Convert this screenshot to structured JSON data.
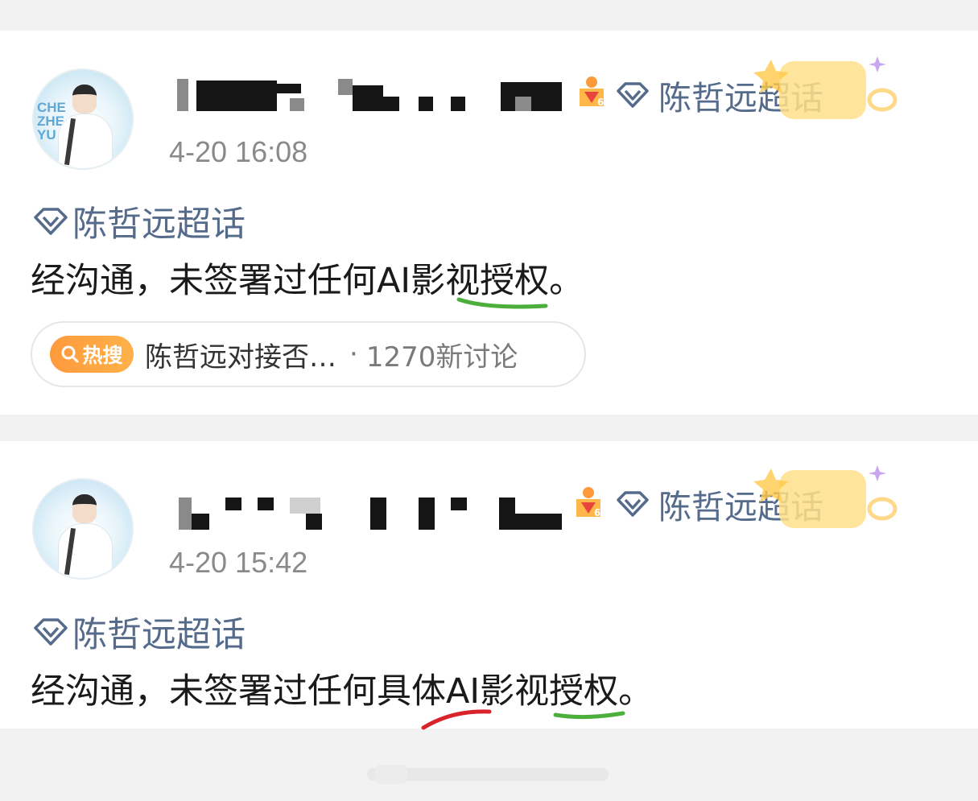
{
  "posts": [
    {
      "time": "4-20 16:08",
      "topic_chip": "陈哲远超话",
      "super_topic": "陈哲远超话",
      "content": "经沟通，未签署过任何AI影视授权。",
      "hot": {
        "tag": "热搜",
        "title": "陈哲远对接否…",
        "count": "1270新讨论"
      }
    },
    {
      "time": "4-20 15:42",
      "topic_chip": "陈哲远超话",
      "super_topic": "陈哲远超话",
      "content": "经沟通，未签署过任何具体AI影视授权。"
    }
  ],
  "avatar_text": "CHE ZHE YU",
  "colors": {
    "topic_blue": "#556b8c",
    "hot_orange": "#ff9a3c",
    "underline_green": "#4caf3c",
    "underline_red": "#d9222a"
  },
  "icons": [
    "diamond-icon",
    "level-badge-icon",
    "search-icon",
    "star-sticker-icon"
  ]
}
